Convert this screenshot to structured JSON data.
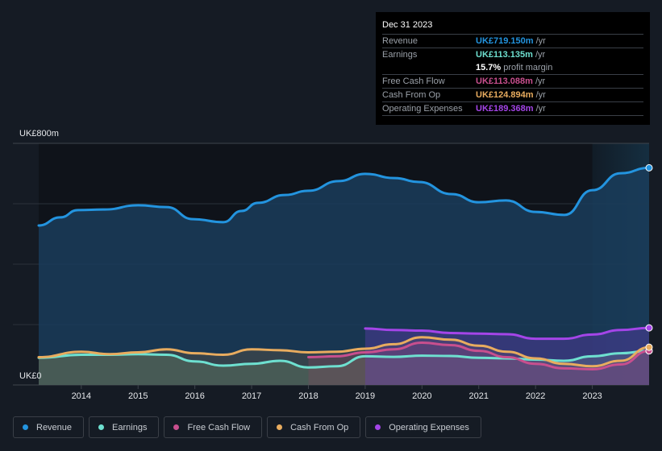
{
  "tooltip": {
    "date": "Dec 31 2023",
    "rows": [
      {
        "label": "Revenue",
        "value": "UK£719.150m",
        "unit": "/yr",
        "color": "#2394df"
      },
      {
        "label": "Earnings",
        "value": "UK£113.135m",
        "unit": "/yr",
        "color": "#6ee0d0"
      },
      {
        "label": "",
        "value": "15.7%",
        "unit": "profit margin",
        "color": "#ffffff"
      },
      {
        "label": "Free Cash Flow",
        "value": "UK£113.088m",
        "unit": "/yr",
        "color": "#c84f8e"
      },
      {
        "label": "Cash From Op",
        "value": "UK£124.894m",
        "unit": "/yr",
        "color": "#e8ac5f"
      },
      {
        "label": "Operating Expenses",
        "value": "UK£189.368m",
        "unit": "/yr",
        "color": "#a445e8"
      }
    ]
  },
  "legend": [
    {
      "label": "Revenue",
      "color": "#2394df"
    },
    {
      "label": "Earnings",
      "color": "#6ee0d0"
    },
    {
      "label": "Free Cash Flow",
      "color": "#c84f8e"
    },
    {
      "label": "Cash From Op",
      "color": "#e8ac5f"
    },
    {
      "label": "Operating Expenses",
      "color": "#a445e8"
    }
  ],
  "chart_data": {
    "type": "area",
    "title": "",
    "xlabel": "",
    "ylabel": "",
    "ylim": [
      0,
      800
    ],
    "xlim": [
      2013.25,
      2024.0
    ],
    "y_tick_labels": [
      {
        "value": 800,
        "label": "UK£800m"
      },
      {
        "value": 0,
        "label": "UK£0"
      }
    ],
    "gridlines_y": [
      0,
      200,
      400,
      600,
      800
    ],
    "x_ticks": [
      2014,
      2015,
      2016,
      2017,
      2018,
      2019,
      2020,
      2021,
      2022,
      2023
    ],
    "highlight_from": 2023.0,
    "series": [
      {
        "name": "Revenue",
        "color": "#2394df",
        "x": [
          2013.25,
          2013.63,
          2013.94,
          2014.41,
          2015.0,
          2015.5,
          2015.97,
          2016.5,
          2016.82,
          2017.11,
          2017.58,
          2018.0,
          2018.53,
          2019.0,
          2019.52,
          2019.95,
          2020.52,
          2021.0,
          2021.48,
          2022.0,
          2022.51,
          2023.0,
          2023.5,
          2024.0
        ],
        "values": [
          528,
          555,
          579,
          581,
          595,
          589,
          549,
          539,
          576,
          603,
          629,
          643,
          675,
          699,
          685,
          672,
          632,
          605,
          611,
          573,
          563,
          645,
          701,
          719
        ]
      },
      {
        "name": "Earnings",
        "color": "#6ee0d0",
        "x": [
          2013.25,
          2014.0,
          2014.5,
          2015.0,
          2015.5,
          2016.0,
          2016.5,
          2017.0,
          2017.5,
          2018.0,
          2018.5,
          2019.0,
          2019.5,
          2020.0,
          2020.5,
          2021.0,
          2021.5,
          2022.0,
          2022.5,
          2023.0,
          2023.5,
          2024.0
        ],
        "values": [
          90,
          100,
          100,
          102,
          100,
          78,
          64,
          70,
          80,
          58,
          62,
          95,
          93,
          97,
          96,
          90,
          88,
          84,
          80,
          95,
          105,
          113
        ]
      },
      {
        "name": "Free Cash Flow",
        "color": "#c84f8e",
        "x": [
          2018.0,
          2018.5,
          2019.0,
          2019.5,
          2020.0,
          2020.5,
          2021.0,
          2021.5,
          2022.0,
          2022.5,
          2023.0,
          2023.5,
          2024.0
        ],
        "values": [
          92,
          95,
          108,
          118,
          140,
          132,
          113,
          92,
          70,
          55,
          52,
          68,
          113
        ]
      },
      {
        "name": "Cash From Op",
        "color": "#e8ac5f",
        "x": [
          2013.25,
          2014.0,
          2014.5,
          2015.0,
          2015.5,
          2016.0,
          2016.5,
          2017.0,
          2017.5,
          2018.0,
          2018.5,
          2019.0,
          2019.5,
          2020.0,
          2020.5,
          2021.0,
          2021.5,
          2022.0,
          2022.5,
          2023.0,
          2023.5,
          2024.0
        ],
        "values": [
          92,
          110,
          102,
          108,
          118,
          105,
          100,
          118,
          115,
          108,
          110,
          120,
          135,
          158,
          150,
          130,
          110,
          88,
          70,
          62,
          80,
          125
        ]
      },
      {
        "name": "Operating Expenses",
        "color": "#a445e8",
        "x": [
          2019.0,
          2019.5,
          2020.0,
          2020.5,
          2021.0,
          2021.5,
          2022.0,
          2022.5,
          2023.0,
          2023.5,
          2024.0
        ],
        "values": [
          187,
          182,
          180,
          172,
          170,
          168,
          153,
          153,
          167,
          182,
          189
        ]
      }
    ]
  }
}
